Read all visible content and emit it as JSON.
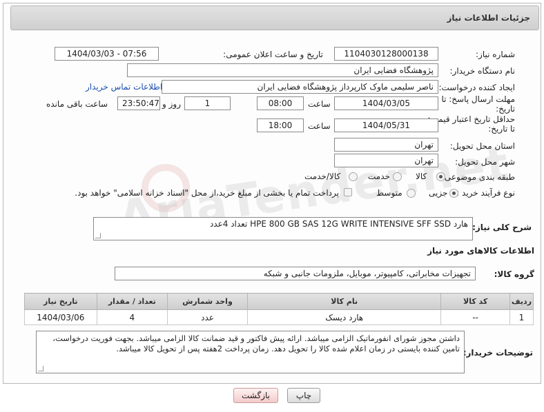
{
  "header": {
    "title": "جزئیات اطلاعات نیاز"
  },
  "form": {
    "need_number": {
      "label": "شماره نیاز:",
      "value": "1104030128000138"
    },
    "announce": {
      "label": "تاریخ و ساعت اعلان عمومی:",
      "value": "1404/03/03 - 07:56"
    },
    "buyer_org": {
      "label": "نام دستگاه خریدار:",
      "value": "پژوهشگاه فضایی ایران"
    },
    "creator": {
      "label": "ایجاد کننده درخواست:",
      "value": "ناصر سلیمی ماوک کارپرداز پژوهشگاه فضایی ایران",
      "contact_link": "اطلاعات تماس خریدار"
    },
    "deadline": {
      "label_line1": "مهلت ارسال پاسخ: تا",
      "label_line2": "تاریخ:",
      "date": "1404/03/05",
      "time_label": "ساعت",
      "time": "08:00",
      "days": "1",
      "days_label": "روز و",
      "remaining": "23:50:47",
      "remaining_label": "ساعت باقی مانده"
    },
    "validity": {
      "label_line1": "حداقل تاریخ اعتبار قیمت:",
      "label_line2": "تا تاریخ:",
      "date": "1404/05/31",
      "time_label": "ساعت",
      "time": "18:00"
    },
    "province": {
      "label": "استان محل تحویل:",
      "value": "تهران"
    },
    "city": {
      "label": "شهر محل تحویل:",
      "value": "تهران"
    },
    "category": {
      "label": "طبقه بندی موضوعی:",
      "options": [
        "کالا",
        "خدمت",
        "کالا/خدمت"
      ],
      "selected": "کالا"
    },
    "purchase_type": {
      "label": "نوع فرآیند خرید :",
      "options": [
        "جزیی",
        "متوسط"
      ],
      "selected": "جزیی",
      "note": "پرداخت تمام یا بخشی از مبلغ خرید،از محل \"اسناد خزانه اسلامی\" خواهد بود."
    },
    "description": {
      "label": "شرح کلی نیاز:",
      "value": "هارد HPE 800 GB SAS 12G WRITE INTENSIVE SFF SSD تعداد 4عدد"
    }
  },
  "goods": {
    "section_title": "اطلاعات کالاهای مورد نیاز",
    "group_label": "گروه کالا:",
    "group_value": "تجهیزات مخابراتی، کامپیوتر، موبایل، ملزومات جانبی و شبکه",
    "columns": [
      "ردیف",
      "کد کالا",
      "نام کالا",
      "واحد شمارش",
      "تعداد / مقدار",
      "تاریخ نیاز"
    ],
    "rows": [
      {
        "row": "1",
        "code": "--",
        "name": "هارد دیسک",
        "unit": "عدد",
        "qty": "4",
        "date": "1404/03/06"
      }
    ]
  },
  "buyer_notes": {
    "label": "توضیحات خریدار:",
    "value": "داشتن مجوز شورای انفورماتیک الزامی میباشد. ارائه پیش فاکتور و قید ضمانت کالا الزامی میباشد. بجهت فوریت درخواست، تامین کننده بایستی در زمان اعلام شده کالا را تحویل دهد. زمان پرداخت 2هفته پس از تحویل کالا میباشد."
  },
  "buttons": {
    "print": "چاپ",
    "back": "بازگشت"
  },
  "colors": {
    "link": "#1a4fb0",
    "header_bg": "#d6d6d6",
    "back_button": "#f3caca"
  }
}
